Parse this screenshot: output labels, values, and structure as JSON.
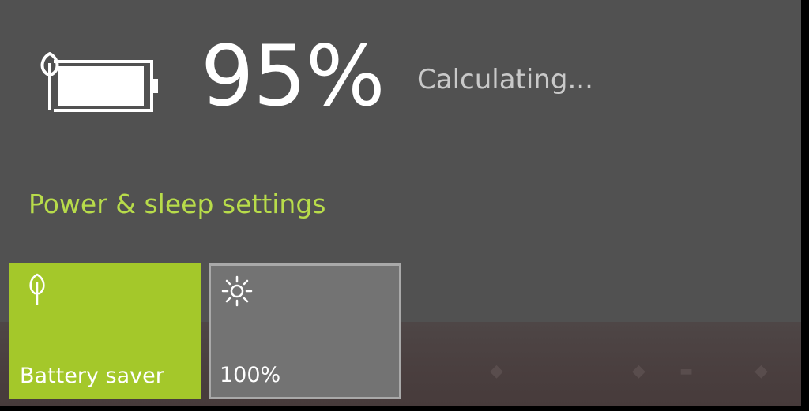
{
  "battery": {
    "level_text": "95%",
    "level": 95,
    "status": "Calculating...",
    "icon": "battery-saver-icon"
  },
  "links": {
    "power_sleep": "Power & sleep settings"
  },
  "quick_actions": [
    {
      "label": "Battery saver",
      "icon": "leaf-icon",
      "state": "on"
    },
    {
      "label": "100%",
      "icon": "brightness-icon",
      "state": "off"
    }
  ],
  "colors": {
    "accent": "#a4c82a",
    "link": "#b8dc4a",
    "flyout_bg": "#515151",
    "tile_off_bg": "#737373"
  }
}
